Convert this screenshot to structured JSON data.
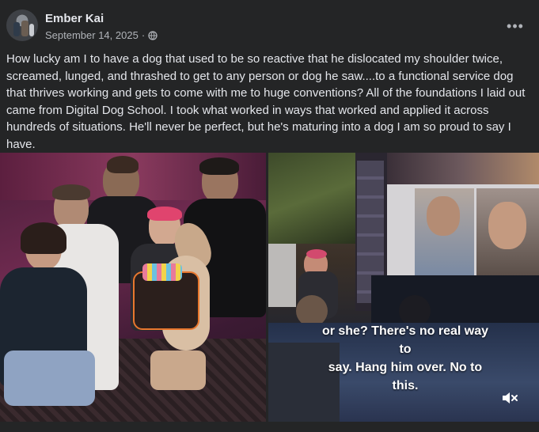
{
  "post": {
    "author": "Ember Kai",
    "date": "September 14, 2025",
    "separator": "·",
    "more_label": "•••",
    "text": "How lucky am I to have a dog that used to be so reactive that he dislocated my shoulder twice, screamed, lunged, and thrashed to get to any person or dog he saw....to a functional service dog that thrives working and gets to come with me to huge conventions? All of the foundations I laid out came from Digital Dog School. I took what worked in ways that worked and applied it across hundreds of situations. He'll never be perfect, but he's maturing into a dog I am so proud to say I have."
  },
  "video": {
    "caption_lines": [
      "or she? There's no real way",
      "to",
      "say. Hang him over. No to",
      "this."
    ]
  },
  "icons": {
    "globe": "globe-icon",
    "more": "more-horizontal-icon",
    "mute": "speaker-muted-icon"
  }
}
